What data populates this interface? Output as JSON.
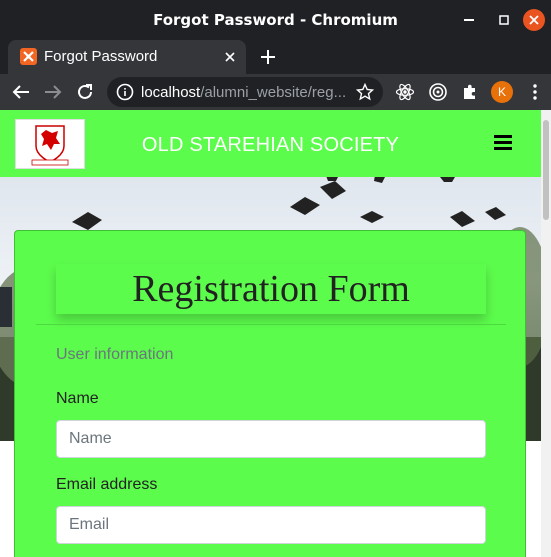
{
  "window": {
    "title": "Forgot Password - Chromium"
  },
  "tab": {
    "title": "Forgot Password"
  },
  "address_bar": {
    "host": "localhost",
    "path": "/alumni_website/reg..."
  },
  "profile": {
    "initial": "K"
  },
  "site": {
    "brand": "OLD STAREHIAN SOCIETY",
    "accent": "#5cfc4c"
  },
  "form": {
    "title": "Registration Form",
    "section": "User information",
    "fields": [
      {
        "label": "Name",
        "placeholder": "Name"
      },
      {
        "label": "Email address",
        "placeholder": "Email"
      }
    ]
  }
}
